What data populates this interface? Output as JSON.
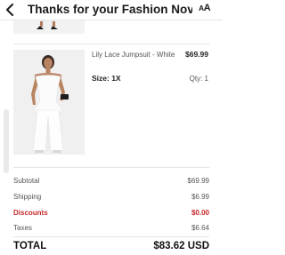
{
  "header": {
    "title": "Thanks for your Fashion Nova ord...",
    "back_icon": "chevron-left-icon",
    "text_size_icon": "text-size-icon",
    "text_size_label_large": "A",
    "text_size_label_small": "A"
  },
  "items": [
    {
      "image": "product-photo-partial"
    },
    {
      "name": "Lily Lace Jumpsuit - White",
      "price": "$69.99",
      "size": "Size: 1X",
      "qty": "Qty: 1",
      "image": "product-photo-white-jumpsuit"
    }
  ],
  "summary": {
    "subtotal_label": "Subtotal",
    "subtotal_value": "$69.99",
    "shipping_label": "Shipping",
    "shipping_value": "$6.99",
    "discounts_label": "Discounts",
    "discounts_value": "$0.00",
    "taxes_label": "Taxes",
    "taxes_value": "$6.64",
    "total_label": "TOTAL",
    "total_value": "$83.62 USD"
  },
  "colors": {
    "discount": "#c62828",
    "text": "#222222",
    "muted": "#555555"
  }
}
